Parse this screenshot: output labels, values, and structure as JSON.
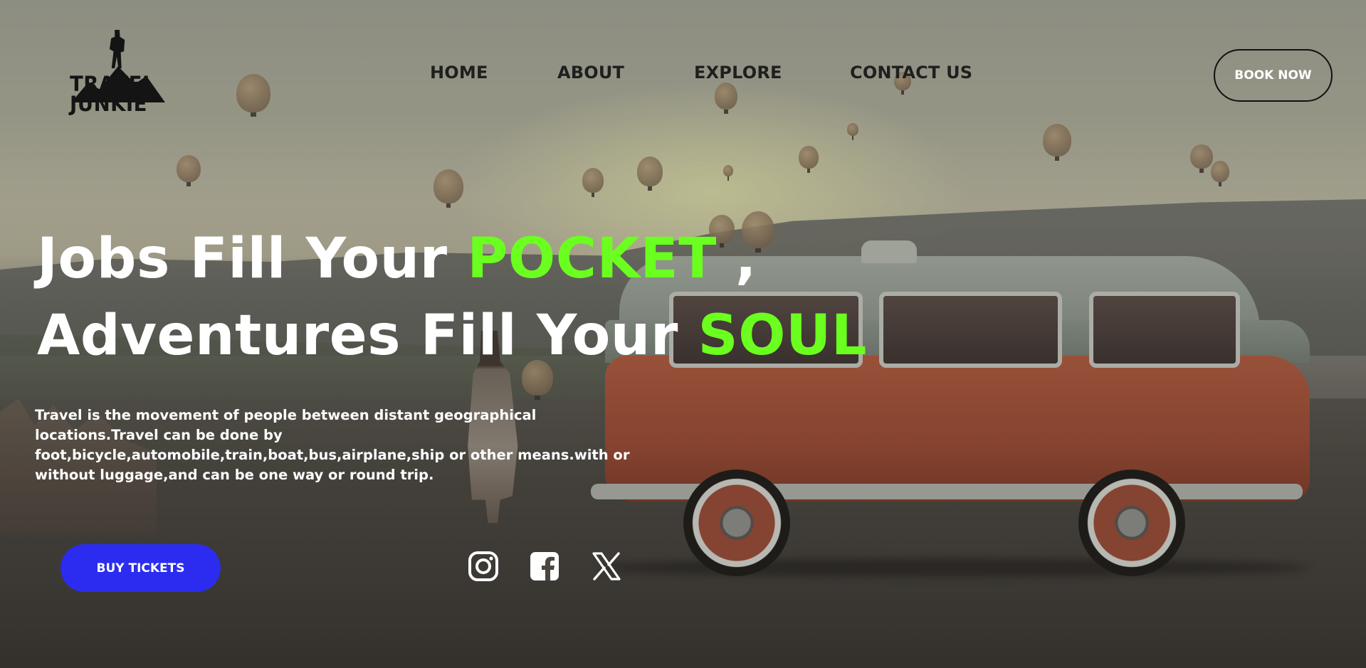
{
  "brand": {
    "line1": "TRAVEL",
    "line2": "JUNKIE"
  },
  "nav": {
    "items": [
      {
        "label": "HOME"
      },
      {
        "label": "ABOUT"
      },
      {
        "label": "EXPLORE"
      },
      {
        "label": "CONTACT US"
      }
    ],
    "book_label": "BOOK NOW"
  },
  "hero": {
    "line1_text": "Jobs Fill Your ",
    "line1_accent": "POCKET",
    "line1_comma": ",",
    "line2_text": "Adventures Fill Your ",
    "line2_accent": "SOUL",
    "description": "Travel is the movement of people between distant geographical locations.Travel can be done by foot,bicycle,automobile,train,boat,bus,airplane,ship or other means.with or without luggage,and can be one way or round trip.",
    "cta_label": "BUY TICKETS"
  },
  "social": [
    "instagram-icon",
    "facebook-icon",
    "x-icon"
  ],
  "colors": {
    "accent": "#6bff1f",
    "cta": "#2b2cf0",
    "text": "#ffffff",
    "nav_text": "#1f1f1f"
  }
}
